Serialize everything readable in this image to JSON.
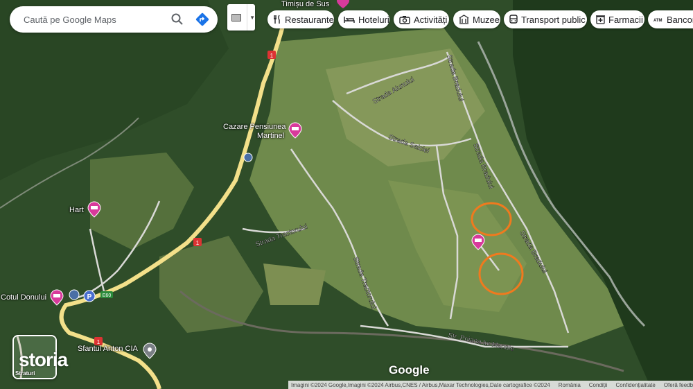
{
  "search": {
    "placeholder": "Caută pe Google Maps"
  },
  "chips": [
    {
      "label": "Restaurante",
      "icon": "fork-knife-icon"
    },
    {
      "label": "Hoteluri",
      "icon": "bed-icon"
    },
    {
      "label": "Activități",
      "icon": "camera-icon"
    },
    {
      "label": "Muzee",
      "icon": "museum-icon"
    },
    {
      "label": "Transport public",
      "icon": "bus-icon"
    },
    {
      "label": "Farmacii",
      "icon": "pharmacy-icon"
    },
    {
      "label": "Bancom",
      "icon": "atm-icon"
    }
  ],
  "places": {
    "timisu": "Timișu de Sus",
    "cazare_line1": "Cazare Pensiunea",
    "cazare_line2": "Martinel",
    "hart": "Hart",
    "cotul": "Cotul Donului",
    "sfantul": "Sfantul Anton CIA"
  },
  "streets": {
    "alunului": "Strada Alunului",
    "salciei": "Strada Salciei",
    "bradului_upper": "Strada Bradului",
    "bradului_lower": "Strada Bradului",
    "tractorului_upper": "Strada Tractorului",
    "tractorului_lower": "Strada Tractorului",
    "poiana": "Str. Poiana lui Manole"
  },
  "road_shields": {
    "r1a": "1",
    "r1b": "1",
    "r1c": "1",
    "e60": "E60"
  },
  "layers": {
    "label": "Straturi"
  },
  "watermark": "storia",
  "google_logo": "Google",
  "footer": {
    "attribution": "Imagini ©2024 Google,Imagini ©2024 Airbus,CNES / Airbus,Maxar Technologies,Date cartografice ©2024",
    "country": "România",
    "terms": "Condiții",
    "privacy": "Confidențialitate",
    "feedback": "Oferă feedb"
  },
  "colors": {
    "forest": "#2c4a26",
    "clearing": "#6d8a4a",
    "road_main": "#f3e08a",
    "marker_orange": "#f07a1e",
    "hotel_pin": "#d83a9b",
    "directions_blue": "#1a73e8"
  }
}
